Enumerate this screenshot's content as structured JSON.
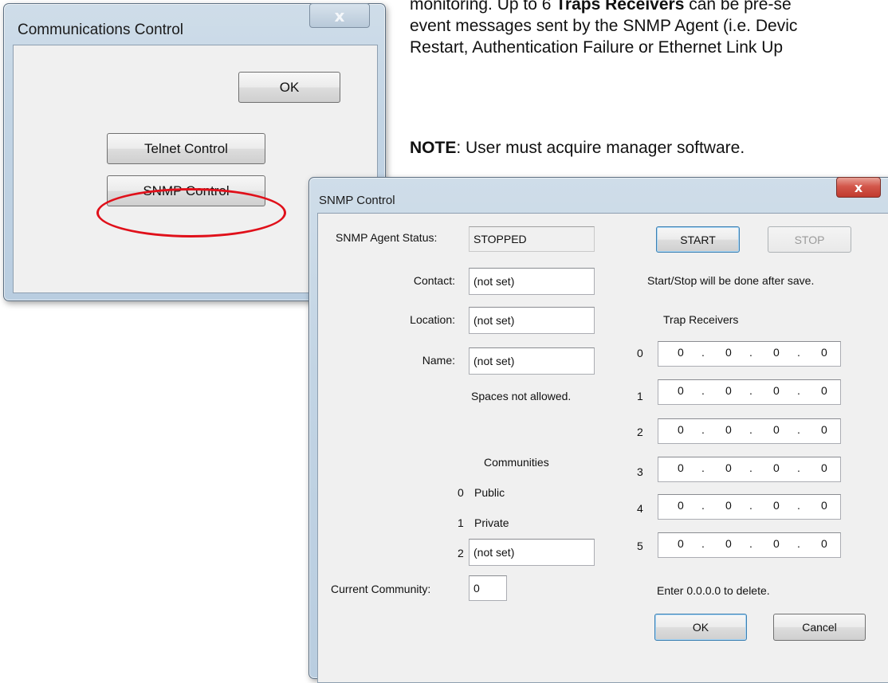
{
  "document": {
    "line1_a": "monitoring.  Up to 6 ",
    "line1_b": "Traps Receivers",
    "line1_c": " can be pre-se",
    "line2": "event messages sent by the SNMP Agent (i.e. Devic",
    "line3": "Restart, Authentication Failure or Ethernet Link Up",
    "note_label": "NOTE",
    "note_text": ":  User must acquire manager software."
  },
  "comm_dialog": {
    "title": "Communications Control",
    "close_glyph": "x",
    "ok_label": "OK",
    "telnet_label": "Telnet Control",
    "snmp_label": "SNMP Control"
  },
  "snmp_dialog": {
    "title": "SNMP Control",
    "close_glyph": "x",
    "agent_status_label": "SNMP Agent Status:",
    "agent_status_value": "STOPPED",
    "start_label": "START",
    "stop_label": "STOP",
    "start_stop_note": "Start/Stop will be done after save.",
    "contact_label": "Contact:",
    "contact_value": "(not set)",
    "location_label": "Location:",
    "location_value": "(not set)",
    "name_label": "Name:",
    "name_value": "(not set)",
    "spaces_note": "Spaces not allowed.",
    "trap_receivers_label": "Trap Receivers",
    "trap_receivers": [
      {
        "index": "0",
        "octets": [
          "0",
          "0",
          "0",
          "0"
        ]
      },
      {
        "index": "1",
        "octets": [
          "0",
          "0",
          "0",
          "0"
        ]
      },
      {
        "index": "2",
        "octets": [
          "0",
          "0",
          "0",
          "0"
        ]
      },
      {
        "index": "3",
        "octets": [
          "0",
          "0",
          "0",
          "0"
        ]
      },
      {
        "index": "4",
        "octets": [
          "0",
          "0",
          "0",
          "0"
        ]
      },
      {
        "index": "5",
        "octets": [
          "0",
          "0",
          "0",
          "0"
        ]
      }
    ],
    "ip_dot": ".",
    "communities_label": "Communities",
    "communities": [
      {
        "index": "0",
        "value": "Public"
      },
      {
        "index": "1",
        "value": "Private"
      },
      {
        "index": "2",
        "value": "(not set)"
      }
    ],
    "current_community_label": "Current Community:",
    "current_community_value": "0",
    "delete_note": "Enter 0.0.0.0 to delete.",
    "ok_label": "OK",
    "cancel_label": "Cancel"
  },
  "colors": {
    "highlight_circle": "#e0101a",
    "close_button_red": "#c9463d",
    "window_frame": "#c2d4e4"
  }
}
